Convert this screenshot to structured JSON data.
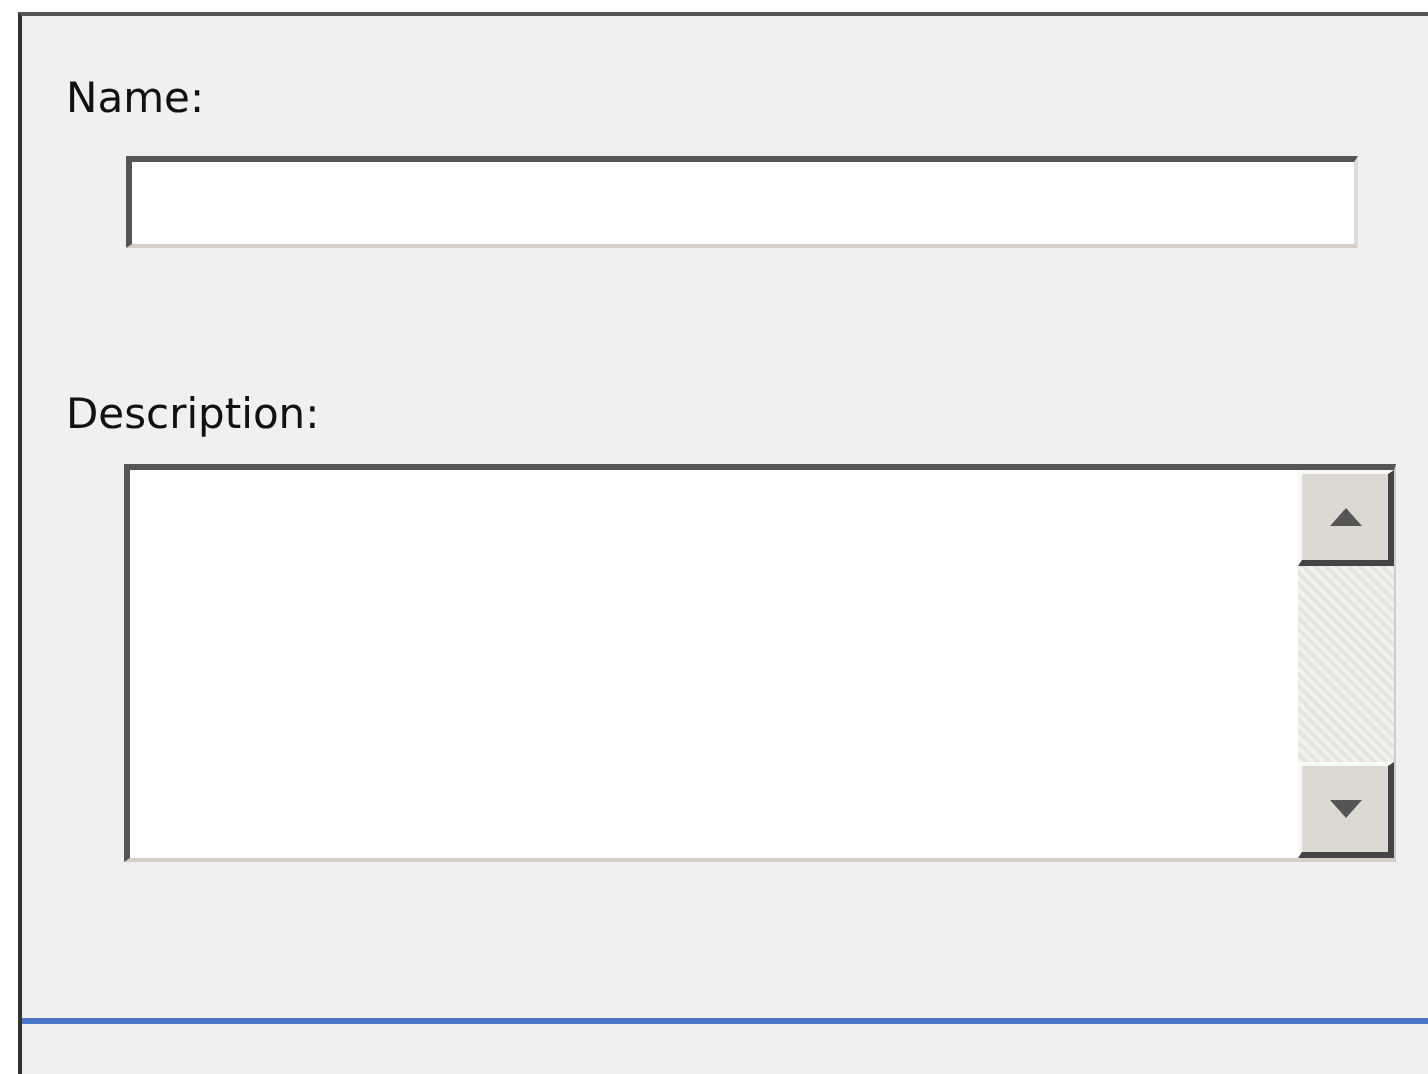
{
  "form": {
    "fields": [
      {
        "kind": "text",
        "label": "Name:"
      },
      {
        "kind": "textarea",
        "label": "Description:"
      }
    ]
  }
}
